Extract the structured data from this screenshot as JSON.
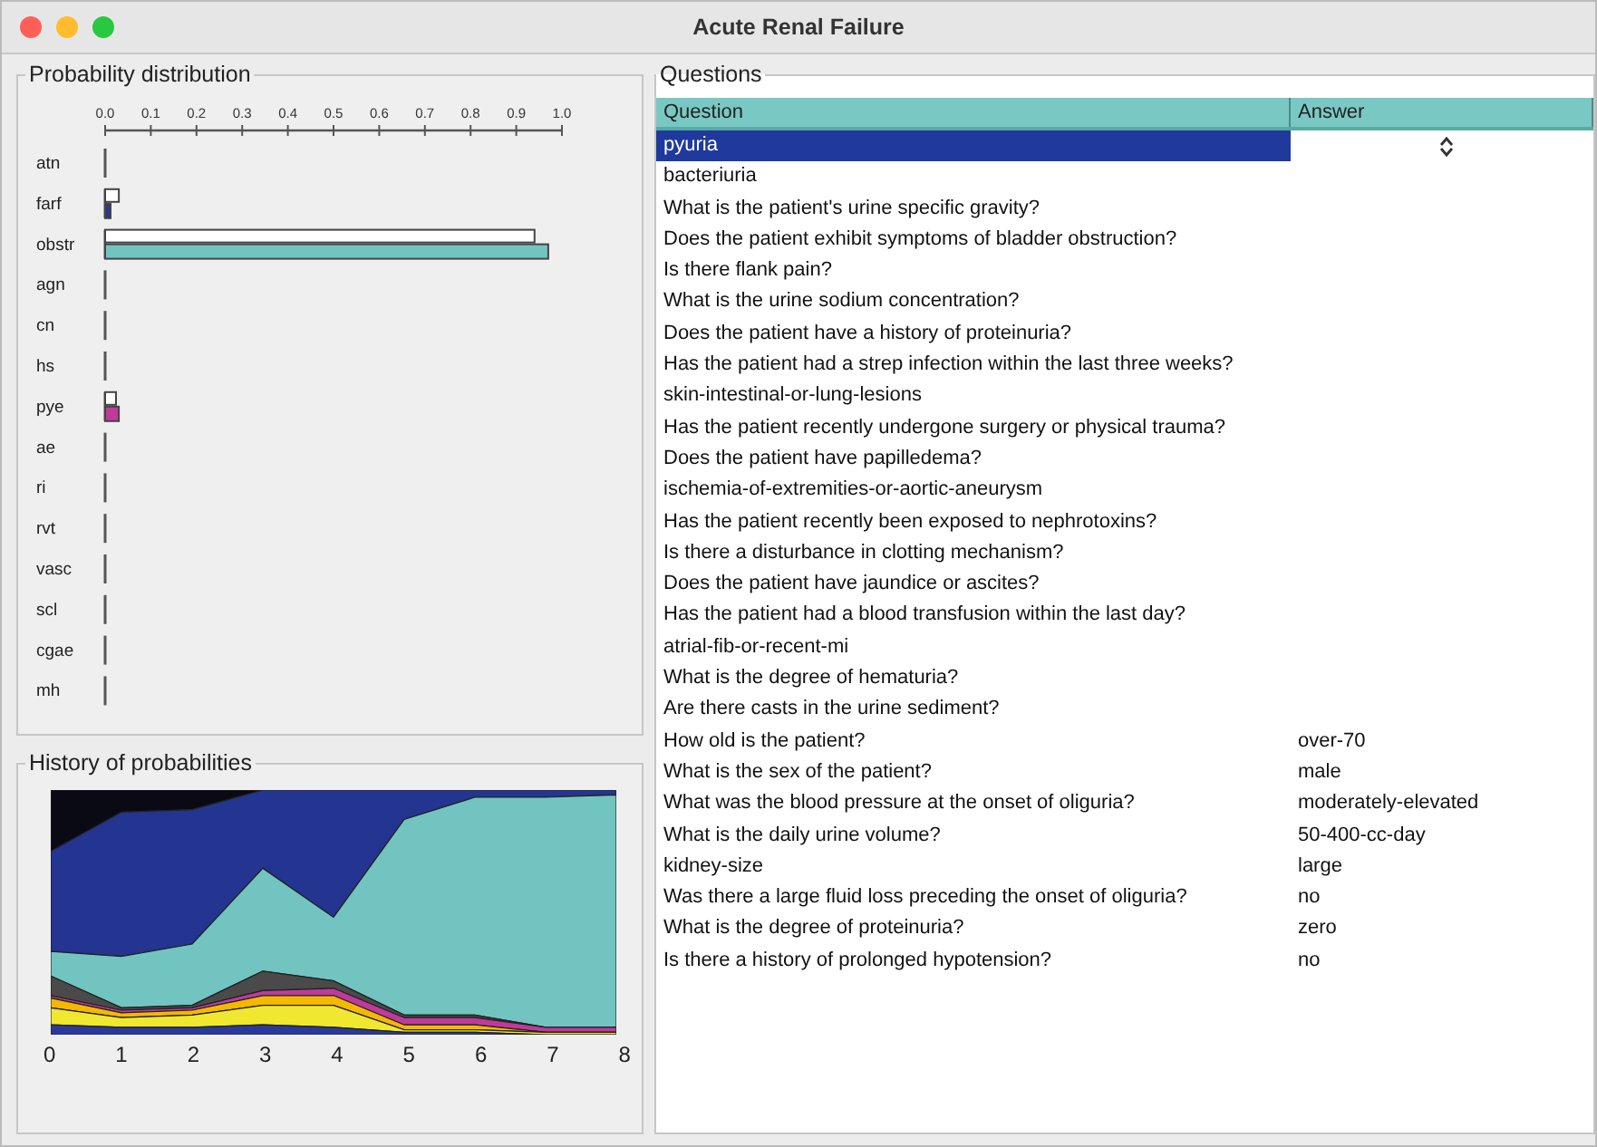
{
  "window": {
    "title": "Acute Renal Failure"
  },
  "distribution": {
    "title": "Probability distribution",
    "chart_data": {
      "type": "bar",
      "orientation": "horizontal",
      "categories": [
        "atn",
        "farf",
        "obstr",
        "agn",
        "cn",
        "hs",
        "pye",
        "ae",
        "ri",
        "rvt",
        "vasc",
        "scl",
        "cgae",
        "mh"
      ],
      "xlim": [
        0,
        1
      ],
      "xticks": [
        {
          "value": 0,
          "label": "0.0"
        },
        {
          "value": 0.1,
          "label": "0.1"
        },
        {
          "value": 0.2,
          "label": "0.2"
        },
        {
          "value": 0.3,
          "label": "0.3"
        },
        {
          "value": 0.4,
          "label": "0.4"
        },
        {
          "value": 0.5,
          "label": "0.5"
        },
        {
          "value": 0.6,
          "label": "0.6"
        },
        {
          "value": 0.7,
          "label": "0.7"
        },
        {
          "value": 0.8,
          "label": "0.8"
        },
        {
          "value": 0.9,
          "label": "0.9"
        },
        {
          "value": 1,
          "label": "1.0"
        }
      ],
      "series": [
        {
          "color": "#ffffff",
          "values": [
            0,
            0.03,
            0.94,
            0,
            0,
            0,
            0.02,
            0,
            0,
            0,
            0,
            0,
            0,
            0
          ]
        },
        {
          "color": "#2a3a8c",
          "values": [
            0,
            0.01,
            null,
            null,
            null,
            null,
            null,
            null,
            null,
            null,
            null,
            null,
            null,
            null
          ]
        },
        {
          "color": "#72c4c0",
          "values": [
            null,
            null,
            0.97,
            null,
            null,
            null,
            null,
            null,
            null,
            null,
            null,
            null,
            null,
            null
          ]
        },
        {
          "color": "#c03a9c",
          "values": [
            null,
            null,
            null,
            null,
            null,
            null,
            0.03,
            null,
            null,
            null,
            null,
            null,
            null,
            null
          ]
        }
      ]
    }
  },
  "history": {
    "title": "History of probabilities",
    "x_labels": [
      "0",
      "1",
      "2",
      "3",
      "4",
      "5",
      "6",
      "7",
      "8"
    ]
  },
  "questions": {
    "title": "Questions",
    "columns": [
      "Question",
      "Answer"
    ],
    "rows": [
      {
        "question": "pyuria",
        "selected": true
      },
      {
        "question": "bacteriuria",
        "selected": false
      },
      {
        "question": "What is the patient's urine specific gravity?",
        "selected": false
      },
      {
        "question": "Does the patient exhibit symptoms of bladder obstruction?",
        "selected": false
      },
      {
        "question": "Is there flank pain?",
        "selected": false
      },
      {
        "question": "What is the urine sodium concentration?",
        "selected": false
      },
      {
        "question": "Does the patient have a history of proteinuria?",
        "selected": false
      },
      {
        "question": "Has the patient had a strep infection within the last three weeks?",
        "selected": false
      },
      {
        "question": "skin-intestinal-or-lung-lesions",
        "selected": false
      },
      {
        "question": "Has the patient recently undergone surgery or physical trauma?",
        "selected": false
      },
      {
        "question": "Does the patient have papilledema?",
        "selected": false
      },
      {
        "question": "ischemia-of-extremities-or-aortic-aneurysm",
        "selected": false
      },
      {
        "question": "Has the patient recently been exposed to nephrotoxins?",
        "selected": false
      },
      {
        "question": "Is there a disturbance in clotting mechanism?",
        "selected": false
      },
      {
        "question": "Does the patient have jaundice or ascites?",
        "selected": false
      },
      {
        "question": "Has the patient had a blood transfusion within the last day?",
        "selected": false
      },
      {
        "question": "atrial-fib-or-recent-mi",
        "selected": false
      },
      {
        "question": "What is the degree of hematuria?",
        "selected": false
      },
      {
        "question": "Are there casts in the urine sediment?",
        "selected": false
      },
      {
        "question": "How old is the patient?",
        "answer": "over-70",
        "selected": false
      },
      {
        "question": "What is the sex of the patient?",
        "answer": "male",
        "selected": false
      },
      {
        "question": "What was the blood pressure at the onset of oliguria?",
        "answer": "moderately-elevated",
        "selected": false
      },
      {
        "question": "What is the daily urine volume?",
        "answer": "50-400-cc-day",
        "selected": false
      },
      {
        "question": "kidney-size",
        "answer": "large",
        "selected": false
      },
      {
        "question": "Was there a large fluid loss preceding the onset of oliguria?",
        "answer": "no",
        "selected": false
      },
      {
        "question": "What is the degree of proteinuria?",
        "answer": "zero",
        "selected": false
      },
      {
        "question": "Is there a history of prolonged hypotension?",
        "answer": "no",
        "selected": false
      }
    ]
  }
}
